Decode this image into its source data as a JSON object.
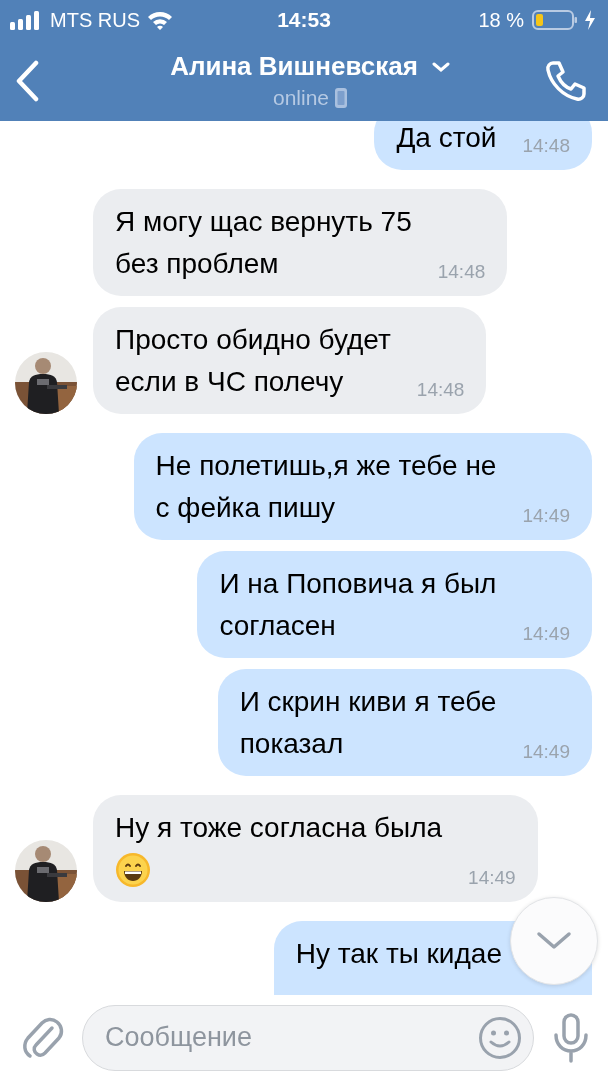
{
  "status_bar": {
    "carrier": "MTS RUS",
    "time": "14:53",
    "battery": "18 %"
  },
  "header": {
    "title": "Алина Вишневская",
    "status": "online"
  },
  "messages": [
    {
      "kind": "out",
      "text": "Да стой",
      "time": "14:48"
    },
    {
      "kind": "in",
      "text": "Я могу щас вернуть 75\nбез проблем",
      "time": "14:48",
      "avatar": false
    },
    {
      "kind": "in",
      "text": "Просто обидно будет\nесли в ЧС полечу",
      "time": "14:48",
      "avatar": true
    },
    {
      "kind": "out",
      "text": "Не полетишь,я же тебе не\nс фейка пишу",
      "time": "14:49"
    },
    {
      "kind": "out",
      "text": "И на Поповича я был\nсогласен",
      "time": "14:49"
    },
    {
      "kind": "out",
      "text": "И скрин киви я тебе\nпоказал",
      "time": "14:49"
    },
    {
      "kind": "in",
      "text": "Ну я тоже согласна была",
      "emoji": true,
      "time": "14:49",
      "avatar": true
    },
    {
      "kind": "out",
      "text": "Ну так ты кидае"
    }
  ],
  "composer": {
    "placeholder": "Сообщение"
  }
}
